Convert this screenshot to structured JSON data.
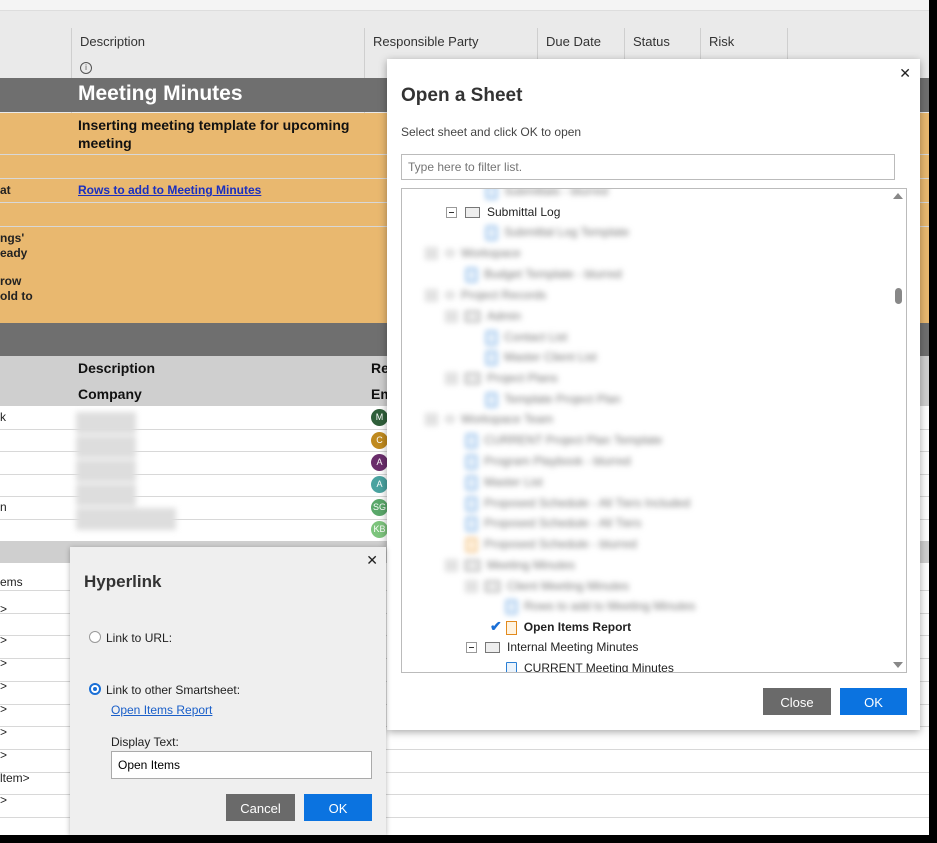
{
  "sheet": {
    "columns": [
      "Description",
      "Responsible Party",
      "Due Date",
      "Status",
      "Risk"
    ],
    "section_title": "Meeting Minutes",
    "template_note": "Inserting meeting template for upcoming meeting",
    "link_text": "Rows to add to Meeting Minutes",
    "left_fragments": [
      "at",
      "ngs'",
      "eady",
      "row",
      "old to"
    ],
    "subheader_1": "Description",
    "subheader_2": "Company",
    "subheader_r1": "Re",
    "subheader_r2": "Em",
    "left_fragments_2": [
      "k",
      "n"
    ],
    "avatar_initials": [
      "M",
      "C",
      "A",
      "A",
      "SG",
      "KB"
    ],
    "avatar_colors": [
      "#2f5f3a",
      "#c08a1e",
      "#6a2d6b",
      "#4aa3a0",
      "#5aa86a",
      "#7cc47c"
    ],
    "lower_fragments": [
      "ems",
      ">",
      ">",
      ">",
      ">",
      ">",
      ">",
      ">",
      "ltem>",
      ">"
    ]
  },
  "open_sheet_dialog": {
    "title": "Open a Sheet",
    "subtitle": "Select sheet and click OK to open",
    "filter_placeholder": "Type here to filter list.",
    "tree": [
      {
        "label": "Submittal Log",
        "type": "folder"
      },
      {
        "label": "Open Items Report",
        "type": "report",
        "selected": true
      },
      {
        "label": "Internal Meeting Minutes",
        "type": "folder"
      },
      {
        "label": "CURRENT Meeting Minutes",
        "type": "sheet"
      }
    ],
    "close_label": "Close",
    "ok_label": "OK"
  },
  "hyperlink_dialog": {
    "title": "Hyperlink",
    "option_url": "Link to URL:",
    "option_sheet": "Link to other Smartsheet:",
    "linked_sheet": "Open Items Report",
    "display_text_label": "Display Text:",
    "display_text_value": "Open Items",
    "cancel_label": "Cancel",
    "ok_label": "OK"
  },
  "colors": {
    "accent": "#0b73e0",
    "orange_row": "#e9b86f",
    "section_gray": "#6f6f6f"
  }
}
